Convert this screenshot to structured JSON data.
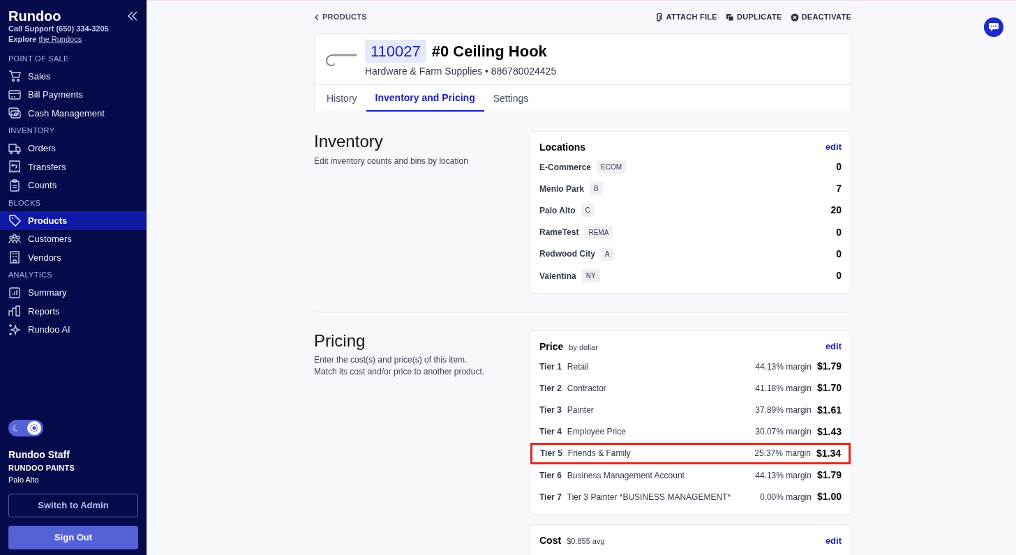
{
  "sidebar": {
    "brand": "Rundoo",
    "support_label": "Call Support",
    "support_phone": "(650) 334-3205",
    "explore_label": "Explore",
    "explore_link": "the Rundocs",
    "sections": [
      {
        "heading": "POINT OF SALE",
        "items": [
          {
            "label": "Sales",
            "selected": false
          },
          {
            "label": "Bill Payments",
            "selected": false
          },
          {
            "label": "Cash Management",
            "selected": false
          }
        ]
      },
      {
        "heading": "INVENTORY",
        "items": [
          {
            "label": "Orders",
            "selected": false
          },
          {
            "label": "Transfers",
            "selected": false
          },
          {
            "label": "Counts",
            "selected": false
          }
        ]
      },
      {
        "heading": "BLOCKS",
        "items": [
          {
            "label": "Products",
            "selected": true
          },
          {
            "label": "Customers",
            "selected": false
          },
          {
            "label": "Vendors",
            "selected": false
          }
        ]
      },
      {
        "heading": "ANALYTICS",
        "items": [
          {
            "label": "Summary",
            "selected": false
          },
          {
            "label": "Reports",
            "selected": false
          },
          {
            "label": "Rundoo AI",
            "selected": false
          }
        ]
      }
    ],
    "theme_toggle": {
      "on": true
    },
    "user": {
      "name": "Rundoo Staff",
      "company": "RUNDOO PAINTS",
      "location": "Palo Alto"
    },
    "buttons": [
      "Switch to Admin",
      "Sign Out"
    ]
  },
  "breadcrumb": "PRODUCTS",
  "actions": [
    "ATTACH FILE",
    "DUPLICATE",
    "DEACTIVATE"
  ],
  "product": {
    "sku": "110027",
    "name": "#0 Ceiling Hook",
    "category": "Hardware & Farm Supplies",
    "separator": "•",
    "barcode": "886780024425"
  },
  "tabs": [
    {
      "label": "History",
      "selected": false
    },
    {
      "label": "Inventory and Pricing",
      "selected": true
    },
    {
      "label": "Settings",
      "selected": false
    }
  ],
  "inventory": {
    "title": "Inventory",
    "description": "Edit inventory counts and bins by location",
    "card_title": "Locations",
    "edit": "edit",
    "locations": [
      {
        "name": "E-Commerce",
        "code": "ECOM",
        "count": "0"
      },
      {
        "name": "Menlo Park",
        "code": "B",
        "count": "7"
      },
      {
        "name": "Palo Alto",
        "code": "C",
        "count": "20"
      },
      {
        "name": "RameTest",
        "code": "REMA",
        "count": "0"
      },
      {
        "name": "Redwood City",
        "code": "A",
        "count": "0"
      },
      {
        "name": "Valentina",
        "code": "NY",
        "count": "0"
      }
    ]
  },
  "pricing": {
    "title": "Pricing",
    "description": [
      "Enter the cost(s) and price(s) of this item.",
      "Match its cost and/or price to another product."
    ],
    "card_title": "Price",
    "card_subtitle": "by dollar",
    "edit": "edit",
    "tiers": [
      {
        "tier": "Tier 1",
        "name": "Retail",
        "margin": "44.13% margin",
        "price": "$1.79",
        "highlighted": false
      },
      {
        "tier": "Tier 2",
        "name": "Contractor",
        "margin": "41.18% margin",
        "price": "$1.70",
        "highlighted": false
      },
      {
        "tier": "Tier 3",
        "name": "Painter",
        "margin": "37.89% margin",
        "price": "$1.61",
        "highlighted": false
      },
      {
        "tier": "Tier 4",
        "name": "Employee Price",
        "margin": "30.07% margin",
        "price": "$1.43",
        "highlighted": false
      },
      {
        "tier": "Tier 5",
        "name": "Friends & Family",
        "margin": "25.37% margin",
        "price": "$1.34",
        "highlighted": true
      },
      {
        "tier": "Tier 6",
        "name": "Business Management Account",
        "margin": "44.13% margin",
        "price": "$1.79",
        "highlighted": false
      },
      {
        "tier": "Tier 7",
        "name": "Tier 3 Painter *BUSINESS MANAGEMENT*",
        "margin": "0.00% margin",
        "price": "$1.00",
        "highlighted": false
      }
    ]
  },
  "cost": {
    "card_title": "Cost",
    "card_subtitle": "$0.855 avg",
    "edit": "edit"
  }
}
